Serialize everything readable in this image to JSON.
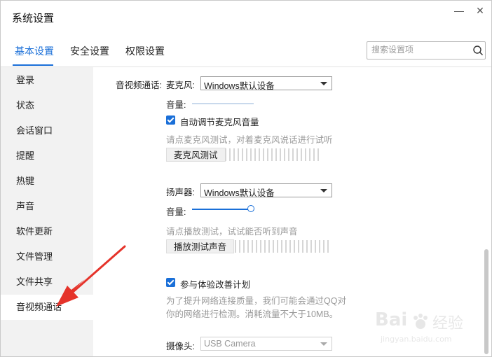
{
  "window": {
    "title": "系统设置",
    "minimize_glyph": "—",
    "close_glyph": "✕"
  },
  "tabs": [
    {
      "label": "基本设置",
      "active": true
    },
    {
      "label": "安全设置",
      "active": false
    },
    {
      "label": "权限设置",
      "active": false
    }
  ],
  "search": {
    "placeholder": "搜索设置项",
    "value": "",
    "icon": "search-icon"
  },
  "sidebar": {
    "items": [
      {
        "label": "登录",
        "active": false
      },
      {
        "label": "状态",
        "active": false
      },
      {
        "label": "会话窗口",
        "active": false
      },
      {
        "label": "提醒",
        "active": false
      },
      {
        "label": "热键",
        "active": false
      },
      {
        "label": "声音",
        "active": false
      },
      {
        "label": "软件更新",
        "active": false
      },
      {
        "label": "文件管理",
        "active": false
      },
      {
        "label": "文件共享",
        "active": false
      },
      {
        "label": "音视频通话",
        "active": true
      }
    ]
  },
  "av": {
    "section_label": "音视频通话:",
    "mic": {
      "label": "麦克风:",
      "device": "Windows默认设备",
      "volume_label": "音量:",
      "volume_level": 0,
      "auto_adjust_label": "自动调节麦克风音量",
      "auto_adjust_checked": true,
      "test_hint": "请点麦克风测试，对着麦克风说话进行试听",
      "test_button": "麦克风测试"
    },
    "speaker": {
      "label": "扬声器:",
      "device": "Windows默认设备",
      "volume_label": "音量:",
      "volume_level": 1.0,
      "test_hint": "请点播放测试，试试能否听到声音",
      "test_button": "播放测试声音"
    },
    "improve": {
      "label": "参与体验改善计划",
      "checked": true,
      "desc_line1": "为了提升网络连接质量，我们可能会通过QQ对",
      "desc_line2": "你的网络进行检测。消耗流量不大于10MB。"
    },
    "camera": {
      "label": "摄像头:",
      "device": "USB Camera"
    }
  },
  "watermark": {
    "brand": "Bai",
    "brand_cn": "经验",
    "url": "jingyan.baidu.com"
  },
  "colors": {
    "accent": "#1a6fd8",
    "annotation_arrow": "#e5332a",
    "sidebar_bg": "#f2f2f2"
  }
}
